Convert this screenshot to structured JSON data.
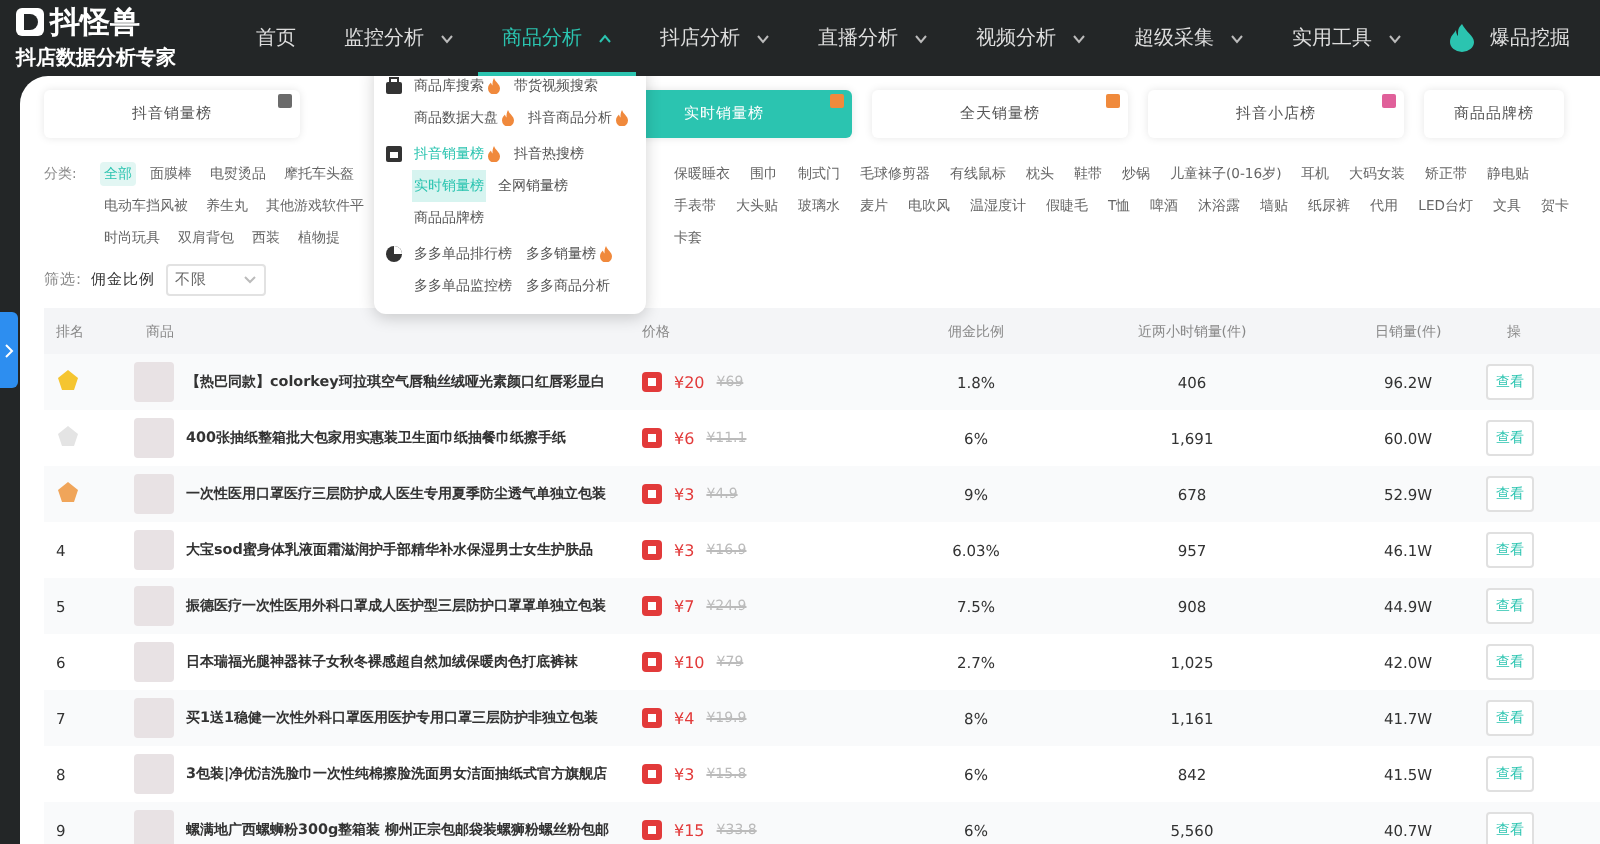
{
  "brand": {
    "logo": "抖怪兽",
    "tagline": "抖店数据分析专家"
  },
  "nav": [
    {
      "label": "首页",
      "selected": false,
      "dropdown": false
    },
    {
      "label": "监控分析",
      "selected": false,
      "dropdown": true
    },
    {
      "label": "商品分析",
      "selected": true,
      "dropdown": true
    },
    {
      "label": "抖店分析",
      "selected": false,
      "dropdown": true
    },
    {
      "label": "直播分析",
      "selected": false,
      "dropdown": true
    },
    {
      "label": "视频分析",
      "selected": false,
      "dropdown": true
    },
    {
      "label": "超级采集",
      "selected": false,
      "dropdown": true
    },
    {
      "label": "实用工具",
      "selected": false,
      "dropdown": true
    },
    {
      "label": "爆品挖掘",
      "selected": false,
      "dropdown": false,
      "kind": "flame"
    }
  ],
  "menu": [
    {
      "kind": "bag",
      "items": [
        {
          "label": "商品库搜索",
          "hot": true,
          "selected": false
        },
        {
          "label": "带货视频搜索",
          "hot": false,
          "selected": false
        },
        {
          "label": "商品数据大盘",
          "hot": true,
          "selected": false
        },
        {
          "label": "抖音商品分析",
          "hot": true,
          "selected": false
        }
      ]
    },
    {
      "kind": "chart",
      "items": [
        {
          "label": "抖音销量榜",
          "hot": true,
          "selected": false,
          "accent": true
        },
        {
          "label": "抖音热搜榜",
          "hot": false,
          "selected": false
        },
        {
          "label": "实时销量榜",
          "hot": false,
          "selected": true
        },
        {
          "label": "全网销量榜",
          "hot": false,
          "selected": false
        },
        {
          "label": "商品品牌榜",
          "hot": false,
          "selected": false
        }
      ]
    },
    {
      "kind": "pie",
      "items": [
        {
          "label": "多多单品排行榜",
          "hot": false,
          "selected": false
        },
        {
          "label": "多多销量榜",
          "hot": true,
          "selected": false
        },
        {
          "label": "多多单品监控榜",
          "hot": false,
          "selected": false
        },
        {
          "label": "多多商品分析",
          "hot": false,
          "selected": false
        }
      ]
    }
  ],
  "tabs": [
    {
      "label": "抖音销量榜",
      "selected": false,
      "color": "#6b6b6b"
    },
    {
      "label": "实时销量榜",
      "selected": true,
      "color": "#f08a3c"
    },
    {
      "label": "全天销量榜",
      "selected": false,
      "color": "#f08a3c"
    },
    {
      "label": "抖音小店榜",
      "selected": false,
      "color": "#e0609a"
    },
    {
      "label": "商品品牌榜",
      "selected": false
    }
  ],
  "category_label": "分类:",
  "category_rows": [
    {
      "left": [
        {
          "label": "全部",
          "selected": true
        },
        {
          "label": "面膜棒",
          "selected": false
        },
        {
          "label": "电熨烫品",
          "selected": false
        },
        {
          "label": "摩托车头盔",
          "selected": false
        }
      ],
      "right": [
        {
          "label": "保暖睡衣",
          "selected": false
        },
        {
          "label": "围巾",
          "selected": false
        },
        {
          "label": "制式门",
          "selected": false
        },
        {
          "label": "毛球修剪器",
          "selected": false
        },
        {
          "label": "有线鼠标",
          "selected": false
        },
        {
          "label": "枕头",
          "selected": false
        },
        {
          "label": "鞋带",
          "selected": false
        },
        {
          "label": "炒锅",
          "selected": false
        },
        {
          "label": "儿童袜子(0-16岁)",
          "selected": false
        },
        {
          "label": "耳机",
          "selected": false
        },
        {
          "label": "大码女装",
          "selected": false
        },
        {
          "label": "矫正带",
          "selected": false
        },
        {
          "label": "静电贴",
          "selected": false
        }
      ]
    },
    {
      "left": [
        {
          "label": "电动车挡风被",
          "selected": false
        },
        {
          "label": "养生丸",
          "selected": false
        },
        {
          "label": "其他游戏软件平",
          "selected": false
        }
      ],
      "right": [
        {
          "label": "手表带",
          "selected": false
        },
        {
          "label": "大头贴",
          "selected": false
        },
        {
          "label": "玻璃水",
          "selected": false
        },
        {
          "label": "麦片",
          "selected": false
        },
        {
          "label": "电吹风",
          "selected": false
        },
        {
          "label": "温湿度计",
          "selected": false
        },
        {
          "label": "假睫毛",
          "selected": false
        },
        {
          "label": "T恤",
          "selected": false
        },
        {
          "label": "啤酒",
          "selected": false
        },
        {
          "label": "沐浴露",
          "selected": false
        },
        {
          "label": "墙贴",
          "selected": false
        },
        {
          "label": "纸尿裤",
          "selected": false
        },
        {
          "label": "代用",
          "selected": false
        },
        {
          "label": "LED台灯",
          "selected": false
        },
        {
          "label": "文具",
          "selected": false
        },
        {
          "label": "贺卡",
          "selected": false
        }
      ]
    },
    {
      "left": [
        {
          "label": "时尚玩具",
          "selected": false
        },
        {
          "label": "双肩背包",
          "selected": false
        },
        {
          "label": "西装",
          "selected": false
        },
        {
          "label": "植物提",
          "selected": false
        }
      ],
      "right": [
        {
          "label": "卡套",
          "selected": false
        }
      ]
    }
  ],
  "filter": {
    "label": "筛选:",
    "field": "佣金比例",
    "value": "不限"
  },
  "table": {
    "columns": [
      "排名",
      "商品",
      "价格",
      "佣金比例",
      "近两小时销量(件)",
      "日销量(件)",
      "操"
    ],
    "rows": [
      {
        "color": "#f5c530",
        "title": "【热巴同款】colorkey珂拉琪空气唇釉丝绒哑光素颜口红唇彩显白",
        "price": "¥20",
        "original_price": "¥69",
        "commission": "1.8%",
        "sales_2h": "406",
        "sales_day": "96.2W",
        "action": "查看"
      },
      {
        "color": "#e4e4e4",
        "title": "400张抽纸整箱批大包家用实惠装卫生面巾纸抽餐巾纸擦手纸",
        "price": "¥6",
        "original_price": "¥11.1",
        "commission": "6%",
        "sales_2h": "1,691",
        "sales_day": "60.0W",
        "action": "查看"
      },
      {
        "color": "#f0a55a",
        "title": "一次性医用口罩医疗三层防护成人医生专用夏季防尘透气单独立包装",
        "price": "¥3",
        "original_price": "¥4.9",
        "commission": "9%",
        "sales_2h": "678",
        "sales_day": "52.9W",
        "action": "查看"
      },
      {
        "rank": "4",
        "title": "大宝sod蜜身体乳液面霜滋润护手部精华补水保湿男士女生护肤品",
        "price": "¥3",
        "original_price": "¥16.9",
        "commission": "6.03%",
        "sales_2h": "957",
        "sales_day": "46.1W",
        "action": "查看"
      },
      {
        "rank": "5",
        "title": "振德医疗一次性医用外科口罩成人医护型三层防护口罩罩单独立包装",
        "price": "¥7",
        "original_price": "¥24.9",
        "commission": "7.5%",
        "sales_2h": "908",
        "sales_day": "44.9W",
        "action": "查看"
      },
      {
        "rank": "6",
        "title": "日本瑞福光腿神器袜子女秋冬裸感超自然加绒保暖肉色打底裤袜",
        "price": "¥10",
        "original_price": "¥79",
        "commission": "2.7%",
        "sales_2h": "1,025",
        "sales_day": "42.0W",
        "action": "查看"
      },
      {
        "rank": "7",
        "title": "买1送1稳健一次性外科口罩医用医护专用口罩三层防护非独立包装",
        "price": "¥4",
        "original_price": "¥19.9",
        "commission": "8%",
        "sales_2h": "1,161",
        "sales_day": "41.7W",
        "action": "查看"
      },
      {
        "rank": "8",
        "title": "3包装|净优洁洗脸巾一次性纯棉擦脸洗面男女洁面抽纸式官方旗舰店",
        "price": "¥3",
        "original_price": "¥15.8",
        "commission": "6%",
        "sales_2h": "842",
        "sales_day": "41.5W",
        "action": "查看"
      },
      {
        "rank": "9",
        "title": "螺满地广西螺蛳粉300g整箱装 柳州正宗包邮袋装螺狮粉螺丝粉包邮",
        "price": "¥15",
        "original_price": "¥33.8",
        "commission": "6%",
        "sales_2h": "5,560",
        "sales_day": "40.7W",
        "action": "查看"
      }
    ]
  }
}
